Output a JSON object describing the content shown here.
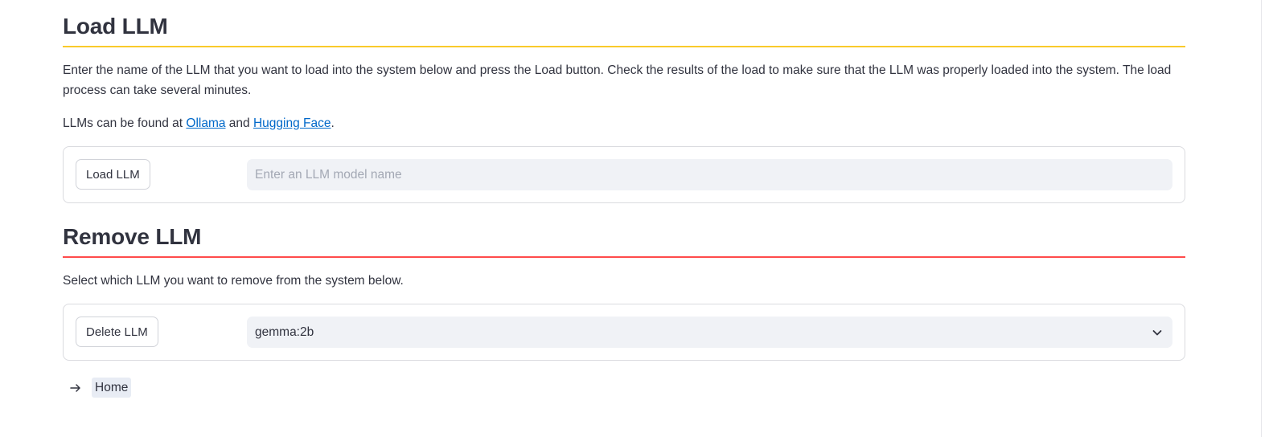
{
  "load_section": {
    "title": "Load LLM",
    "divider_color": "#faca2b",
    "description": "Enter the name of the LLM that you want to load into the system below and press the Load button. Check the results of the load to make sure that the LLM was properly loaded into the system. The load process can take several minutes.",
    "links_prefix": "LLMs can be found at ",
    "link_ollama": "Ollama",
    "links_and": " and ",
    "link_huggingface": "Hugging Face",
    "links_suffix": ".",
    "button_label": "Load LLM",
    "input_placeholder": "Enter an LLM model name",
    "input_value": ""
  },
  "remove_section": {
    "title": "Remove LLM",
    "divider_color": "#ff4b4b",
    "description": "Select which LLM you want to remove from the system below.",
    "button_label": "Delete LLM",
    "selected_model": "gemma:2b"
  },
  "nav": {
    "home_label": "Home",
    "arrow_icon": "arrow-right-icon"
  },
  "colors": {
    "text": "#31333f",
    "link": "#0068c9",
    "field_bg": "#f0f2f6",
    "border": "#dadbdf"
  }
}
